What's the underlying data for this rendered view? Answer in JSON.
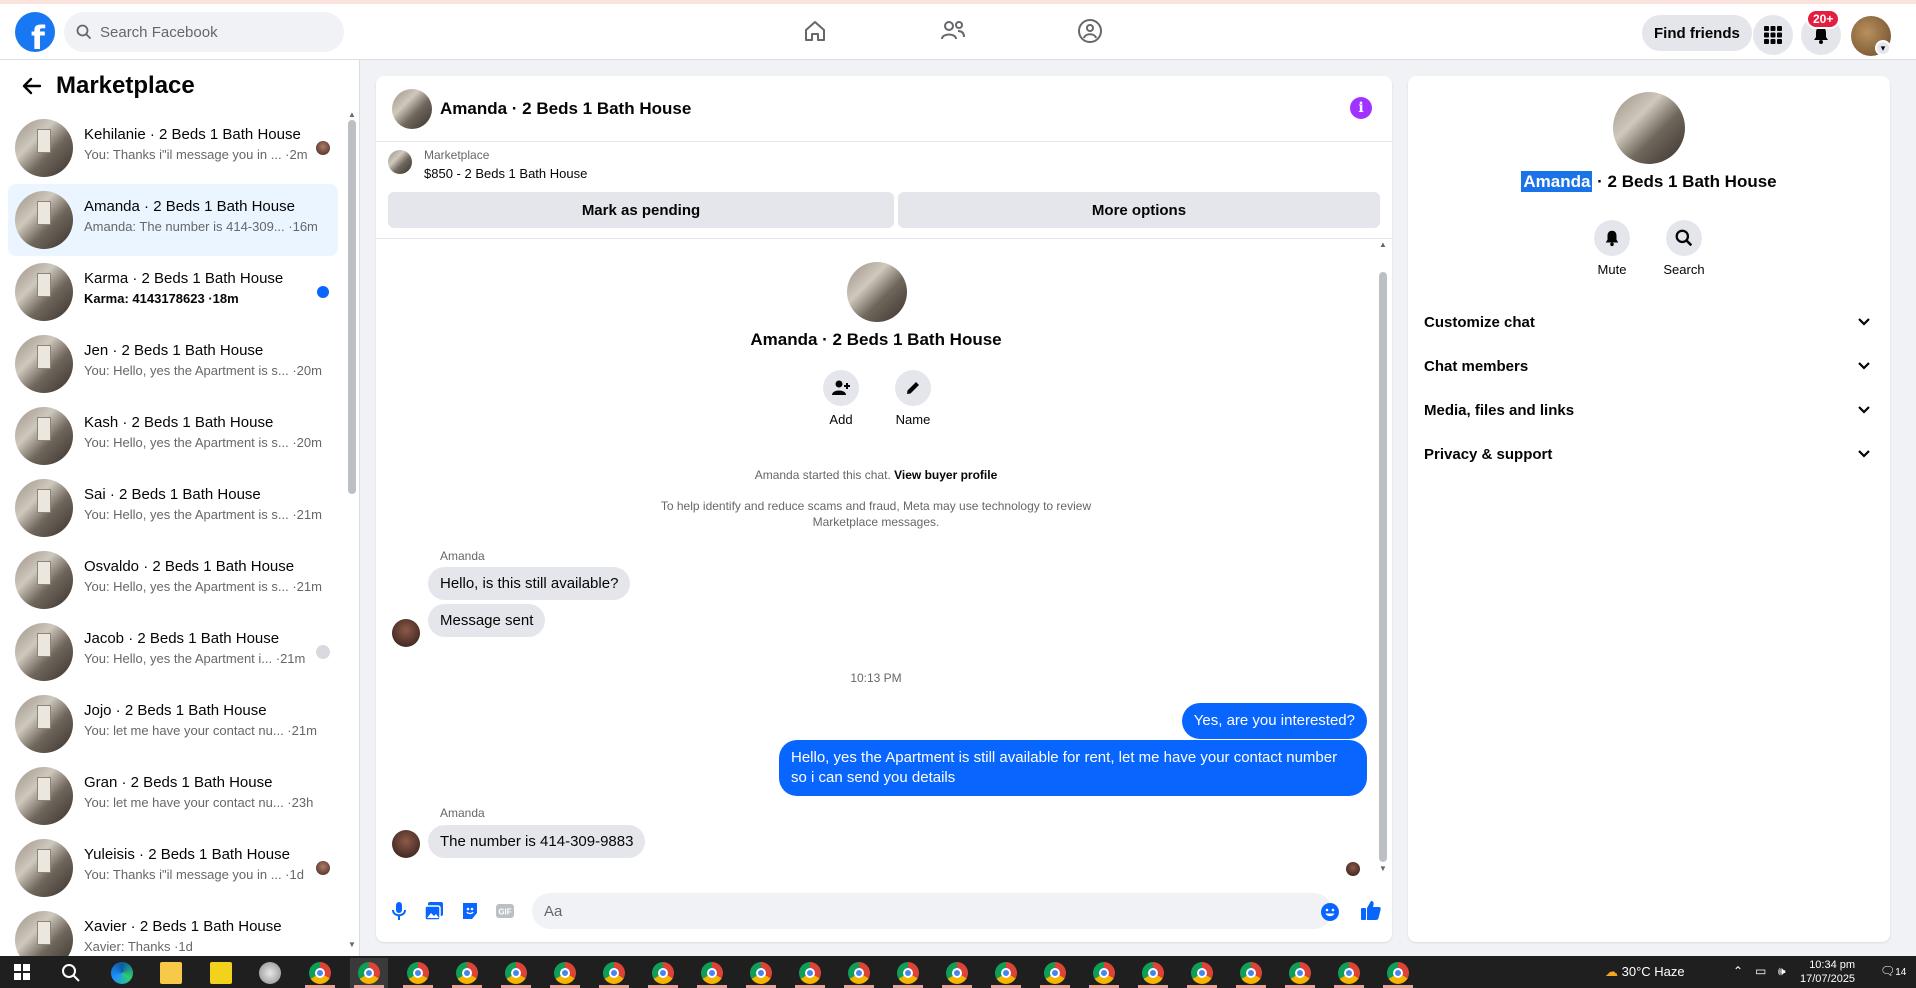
{
  "topbar": {
    "logo": "f",
    "search_placeholder": "Search Facebook",
    "find_friends": "Find friends",
    "notification_count": "20+"
  },
  "left": {
    "title": "Marketplace",
    "conversations": [
      {
        "title": "Kehilanie · 2 Beds 1 Bath House",
        "preview": "You: Thanks i\"il message you in ... ·2m",
        "marker": "face"
      },
      {
        "title": "Amanda · 2 Beds 1 Bath House",
        "preview": "Amanda: The number is 414-309... ·16m",
        "marker": "none"
      },
      {
        "title": "Karma · 2 Beds 1 Bath House",
        "preview": "Karma: 4143178623 ·18m",
        "marker": "dot"
      },
      {
        "title": "Jen · 2 Beds 1 Bath House",
        "preview": "You: Hello, yes the Apartment is s... ·20m",
        "marker": "none"
      },
      {
        "title": "Kash · 2 Beds 1 Bath House",
        "preview": "You: Hello, yes the Apartment is s... ·20m",
        "marker": "none"
      },
      {
        "title": "Sai · 2 Beds 1 Bath House",
        "preview": "You: Hello, yes the Apartment is s... ·21m",
        "marker": "none"
      },
      {
        "title": "Osvaldo · 2 Beds 1 Bath House",
        "preview": "You: Hello, yes the Apartment is s... ·21m",
        "marker": "none"
      },
      {
        "title": "Jacob · 2 Beds 1 Bath House",
        "preview": "You: Hello, yes the Apartment i... ·21m",
        "marker": "grey"
      },
      {
        "title": "Jojo · 2 Beds 1 Bath House",
        "preview": "You: let me have your contact nu... ·21m",
        "marker": "none"
      },
      {
        "title": "Gran · 2 Beds 1 Bath House",
        "preview": "You: let me have your contact nu... ·23h",
        "marker": "none"
      },
      {
        "title": "Yuleisis · 2 Beds 1 Bath House",
        "preview": "You: Thanks i\"il message you in ... ·1d",
        "marker": "face"
      },
      {
        "title": "Xavier · 2 Beds 1 Bath House",
        "preview": "Xavier: Thanks ·1d",
        "marker": "none"
      }
    ]
  },
  "chat": {
    "title": "Amanda · 2 Beds 1 Bath House",
    "marketplace_label": "Marketplace",
    "listing": "$850 - 2 Beds 1 Bath House",
    "mark_pending": "Mark as pending",
    "more_options": "More options",
    "intro_title": "Amanda · 2 Beds 1 Bath House",
    "add_label": "Add",
    "name_label": "Name",
    "started_text": "Amanda started this chat.",
    "view_buyer": "View buyer profile",
    "notice": "To help identify and reduce scams and fraud, Meta may use technology to review Marketplace messages.",
    "sender1": "Amanda",
    "msg1": "Hello, is this still available?",
    "msg2": "Message sent",
    "timestamp": "10:13 PM",
    "out1": "Yes, are you interested?",
    "out2": "Hello, yes the Apartment is still available for rent, let me have your contact number so i can send you details",
    "sender2": "Amanda",
    "msg3": "The number is 414-309-9883",
    "composer_placeholder": "Aa"
  },
  "right": {
    "name_highlight": "Amanda",
    "title_rest": " · 2 Beds 1 Bath House",
    "mute": "Mute",
    "search": "Search",
    "sections": [
      "Customize chat",
      "Chat members",
      "Media, files and links",
      "Privacy & support"
    ]
  },
  "taskbar": {
    "weather": "30°C  Haze",
    "time": "10:34 pm",
    "date": "17/07/2025",
    "notif": "14"
  },
  "colors": {
    "accent": "#0866ff",
    "fb_blue": "#1877f2",
    "badge": "#e41e3f",
    "info": "#a033ff"
  }
}
